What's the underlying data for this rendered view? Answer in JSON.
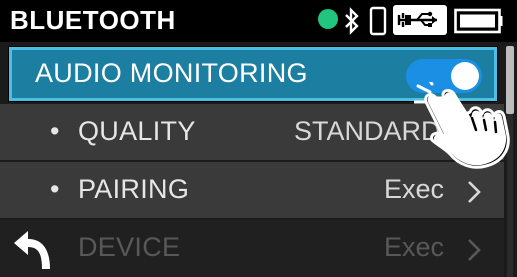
{
  "header": {
    "title": "BLUETOOTH",
    "status_color": "#21c57d",
    "icons": [
      "bluetooth-icon",
      "phone-icon",
      "usb-power-icon",
      "battery-icon"
    ]
  },
  "menu": {
    "audio_monitoring": {
      "label": "AUDIO MONITORING",
      "toggle_on": true,
      "toggle_color": "#1a8fe3"
    },
    "quality": {
      "bullet": "•",
      "label": "QUALITY",
      "value": "STANDARD"
    },
    "pairing": {
      "bullet": "•",
      "label": "PAIRING",
      "value": "Exec"
    },
    "device": {
      "label": "DEVICE",
      "value": "Exec"
    }
  },
  "colors": {
    "selected_row": "#1c7ea0",
    "selected_border": "#4cc0e4",
    "row_bg": "#3a3a3a"
  }
}
